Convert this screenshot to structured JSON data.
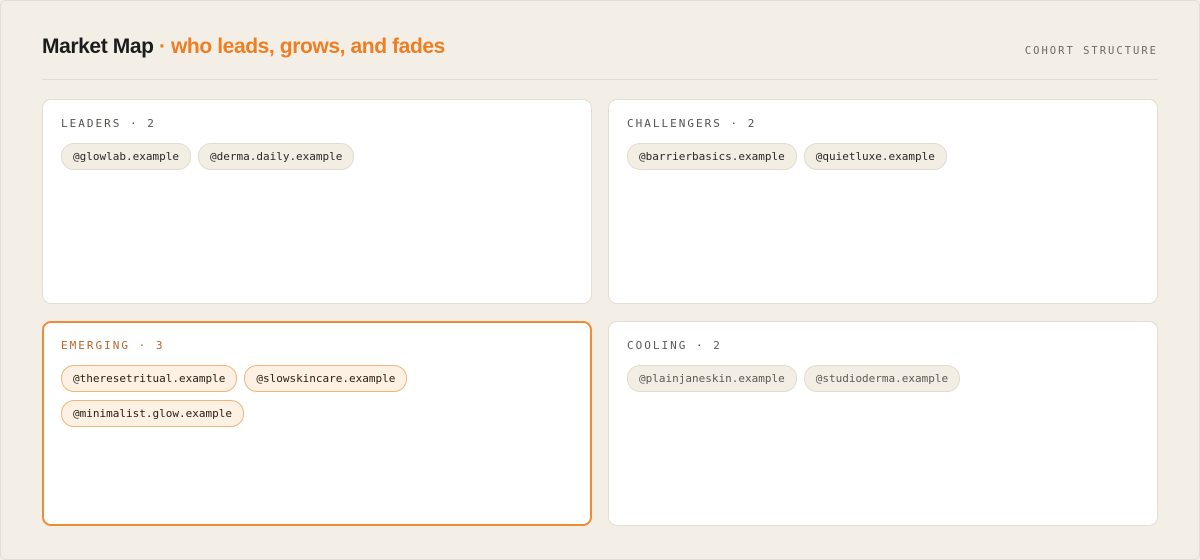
{
  "header": {
    "title_main": "Market Map",
    "title_sep": "·",
    "title_sub": "who leads, grows, and fades",
    "tag": "COHORT STRUCTURE"
  },
  "quadrants": [
    {
      "label": "LEADERS",
      "count": "2",
      "header": "LEADERS · 2",
      "accent": false,
      "accounts": [
        "@glowlab.example",
        "@derma.daily.example"
      ]
    },
    {
      "label": "CHALLENGERS",
      "count": "2",
      "header": "CHALLENGERS · 2",
      "accent": false,
      "accounts": [
        "@barrierbasics.example",
        "@quietluxe.example"
      ]
    },
    {
      "label": "EMERGING",
      "count": "3",
      "header": "EMERGING · 3",
      "accent": true,
      "accounts": [
        "@theresetritual.example",
        "@slowskincare.example",
        "@minimalist.glow.example"
      ]
    },
    {
      "label": "COOLING",
      "count": "2",
      "header": "COOLING · 2",
      "accent": false,
      "accounts": [
        "@plainjaneskin.example",
        "@studioderma.example"
      ]
    }
  ],
  "colors": {
    "background": "#f4efe6",
    "accent": "#ef7d22",
    "emerging_border": "#ef8a35",
    "card": "#ffffff"
  }
}
